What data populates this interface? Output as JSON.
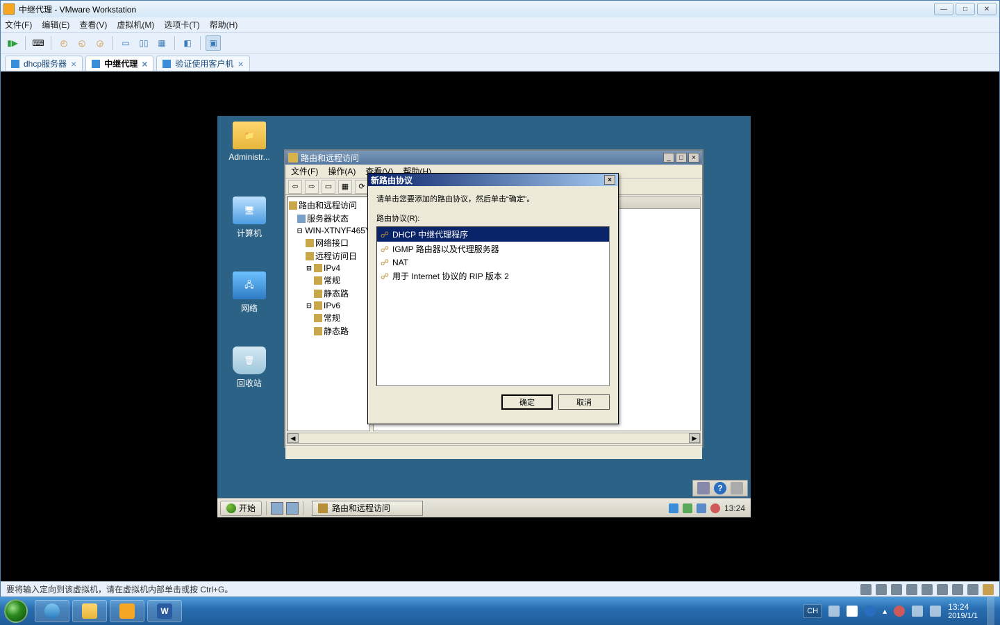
{
  "host_window": {
    "title": "中继代理 - VMware Workstation"
  },
  "vm_menu": {
    "file": "文件(F)",
    "edit": "编辑(E)",
    "view": "查看(V)",
    "vm": "虚拟机(M)",
    "tabs": "选项卡(T)",
    "help": "帮助(H)"
  },
  "vm_tabs": [
    {
      "label": "dhcp服务器",
      "active": false
    },
    {
      "label": "中继代理",
      "active": true
    },
    {
      "label": "验证使用客户机",
      "active": false
    }
  ],
  "guest": {
    "desktop_icons": {
      "admin": "Administr...",
      "computer": "计算机",
      "network": "网络",
      "recycle": "回收站"
    },
    "taskbar": {
      "start": "开始",
      "task_app": "路由和远程访问",
      "clock": "13:24"
    }
  },
  "rras": {
    "title": "路由和远程访问",
    "menu": {
      "file": "文件(F)",
      "action": "操作(A)",
      "view": "查看(V)",
      "help": "帮助(H)"
    },
    "tree": {
      "root": "路由和远程访问",
      "server_status": "服务器状态",
      "server": "WIN-XTNYF465Y",
      "net_if": "网络接口",
      "remote_log": "远程访问日",
      "ipv4": "IPv4",
      "general": "常规",
      "static": "静态路",
      "ipv6": "IPv6"
    }
  },
  "proto_dialog": {
    "title": "新路由协议",
    "instruction": "请单击您要添加的路由协议，然后单击“确定”。",
    "list_label": "路由协议(R):",
    "items": [
      "DHCP 中继代理程序",
      "IGMP 路由器以及代理服务器",
      "NAT",
      "用于 Internet 协议的 RIP 版本 2"
    ],
    "ok": "确定",
    "cancel": "取消"
  },
  "vm_status": {
    "hint": "要将输入定向到该虚拟机，请在虚拟机内部单击或按 Ctrl+G。"
  },
  "host_taskbar": {
    "lang": "CH",
    "time": "13:24",
    "date": "2019/1/1"
  }
}
